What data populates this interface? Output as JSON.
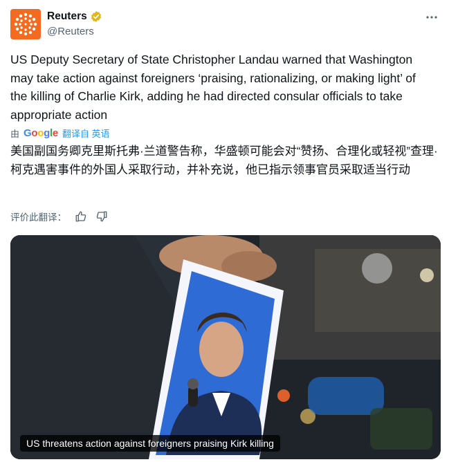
{
  "account": {
    "display_name": "Reuters",
    "handle": "@Reuters",
    "avatar_icon": "reuters-logo-icon",
    "verified_icon": "verified-gold-badge-icon",
    "more_icon": "more-dots-icon",
    "brand_color": "#f26b21"
  },
  "tweet": {
    "text": "US Deputy Secretary of State Christopher Landau warned that Washington may take action against foreigners ‘praising, rationalizing, or making light’ of the killing of Charlie Kirk, adding he had directed consular officials to take appropriate action",
    "translation_by_label": "由",
    "translator_letters": [
      "G",
      "o",
      "o",
      "g",
      "l",
      "e"
    ],
    "translate_link": "翻译自 英语",
    "translated_text": "美国副国务卿克里斯托弗·兰道警告称，华盛顿可能会对“赞扬、合理化或轻视”查理·柯克遇害事件的外国人采取行动，并补充说，他已指示领事官员采取适当行动",
    "rate_label": "评价此翻译：",
    "thumbs_up_icon": "thumbs-up-icon",
    "thumbs_down_icon": "thumbs-down-icon"
  },
  "media": {
    "caption": "US threatens action against foreigners praising Kirk killing"
  }
}
